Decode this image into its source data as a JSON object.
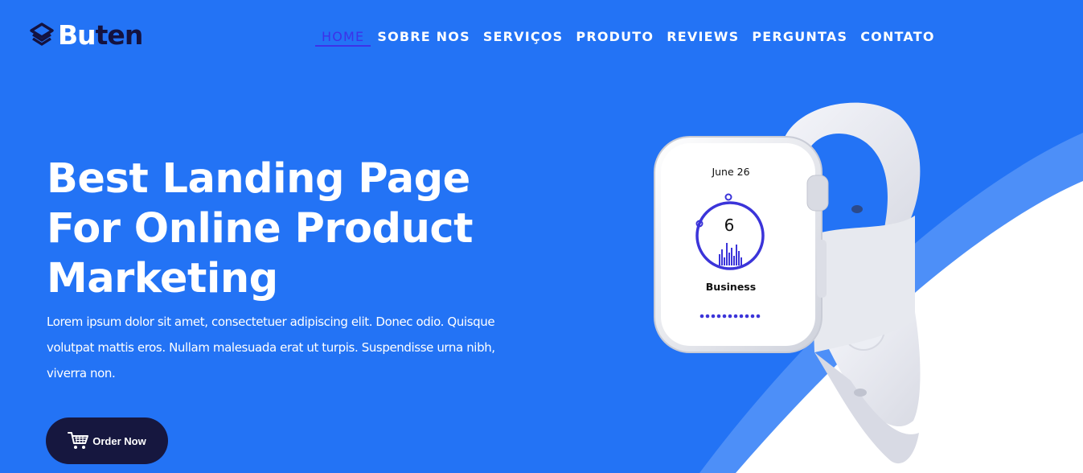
{
  "brand": {
    "name_part1": "Bu",
    "name_part2": "ten",
    "icon": "stacked-layers-icon"
  },
  "nav": {
    "items": [
      {
        "label": "HOME",
        "active": true
      },
      {
        "label": "SOBRE NOS",
        "active": false
      },
      {
        "label": "SERVIÇOS",
        "active": false
      },
      {
        "label": "PRODUTO",
        "active": false
      },
      {
        "label": "REVIEWS",
        "active": false
      },
      {
        "label": "PERGUNTAS",
        "active": false
      },
      {
        "label": "CONTATO",
        "active": false
      }
    ]
  },
  "hero": {
    "headline_lines": [
      "Best Landing Page",
      "For Online Product",
      "Marketing"
    ],
    "description_lines": [
      "Lorem ipsum dolor sit amet, consectetuer adipiscing elit. Donec odio. Quisque",
      "volutpat mattis eros. Nullam malesuada erat ut turpis. Suspendisse urna nibh,",
      "viverra non."
    ],
    "cta": {
      "label": "Order Now",
      "icon": "shopping-cart-icon"
    }
  },
  "watch_screen": {
    "date": "June 26",
    "number": "6",
    "label": "Business"
  },
  "colors": {
    "background": "#2373f5",
    "nav_active": "#3d32e8",
    "brand_dark": "#14123f",
    "button": "#16173f",
    "white": "#ffffff"
  }
}
